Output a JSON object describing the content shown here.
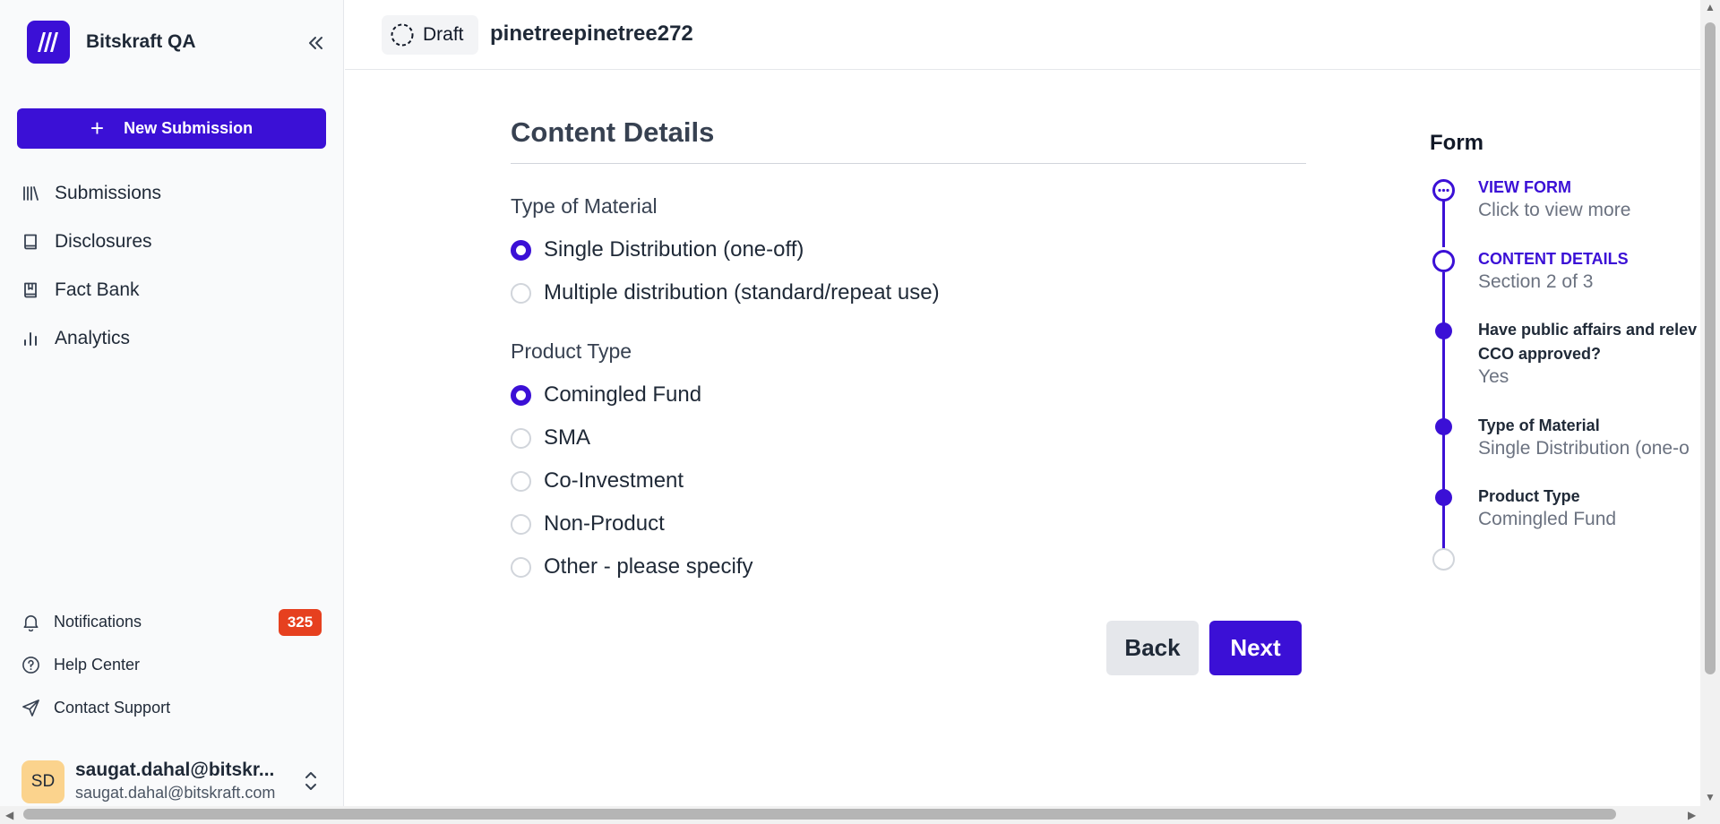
{
  "app": {
    "name": "Bitskraft QA"
  },
  "sidebar": {
    "new_submission_label": "New Submission",
    "nav": [
      {
        "label": "Submissions",
        "icon": "library-icon"
      },
      {
        "label": "Disclosures",
        "icon": "book-icon"
      },
      {
        "label": "Fact Bank",
        "icon": "bookmark-book-icon"
      },
      {
        "label": "Analytics",
        "icon": "bar-chart-icon"
      }
    ],
    "footer": [
      {
        "label": "Notifications",
        "icon": "bell-icon",
        "badge": "325"
      },
      {
        "label": "Help Center",
        "icon": "help-circle-icon"
      },
      {
        "label": "Contact Support",
        "icon": "send-icon"
      }
    ],
    "user": {
      "initials": "SD",
      "name": "saugat.dahal@bitskr...",
      "email": "saugat.dahal@bitskraft.com"
    }
  },
  "topbar": {
    "status": "Draft",
    "submission_name": "pinetreepinetree272"
  },
  "form": {
    "section_title": "Content Details",
    "type_of_material": {
      "label": "Type of Material",
      "options": [
        {
          "label": "Single Distribution (one-off)",
          "selected": true
        },
        {
          "label": "Multiple distribution (standard/repeat use)",
          "selected": false
        }
      ]
    },
    "product_type": {
      "label": "Product Type",
      "options": [
        {
          "label": "Comingled Fund",
          "selected": true
        },
        {
          "label": "SMA",
          "selected": false
        },
        {
          "label": "Co-Investment",
          "selected": false
        },
        {
          "label": "Non-Product",
          "selected": false
        },
        {
          "label": "Other - please specify",
          "selected": false
        }
      ]
    },
    "back_label": "Back",
    "next_label": "Next"
  },
  "progress": {
    "title": "Form",
    "steps": [
      {
        "heading": "VIEW FORM",
        "value": "Click to view more"
      },
      {
        "heading": "CONTENT DETAILS",
        "value": "Section 2 of 3"
      },
      {
        "heading_line1": "Have public affairs and relev",
        "heading_line2": "CCO approved?",
        "value": "Yes"
      },
      {
        "heading": "Type of Material",
        "value": "Single Distribution (one-o"
      },
      {
        "heading": "Product Type",
        "value": "Comingled Fund"
      }
    ]
  },
  "colors": {
    "accent": "#3b10d6",
    "badge": "#e6401f",
    "avatar": "#fbd38d"
  }
}
